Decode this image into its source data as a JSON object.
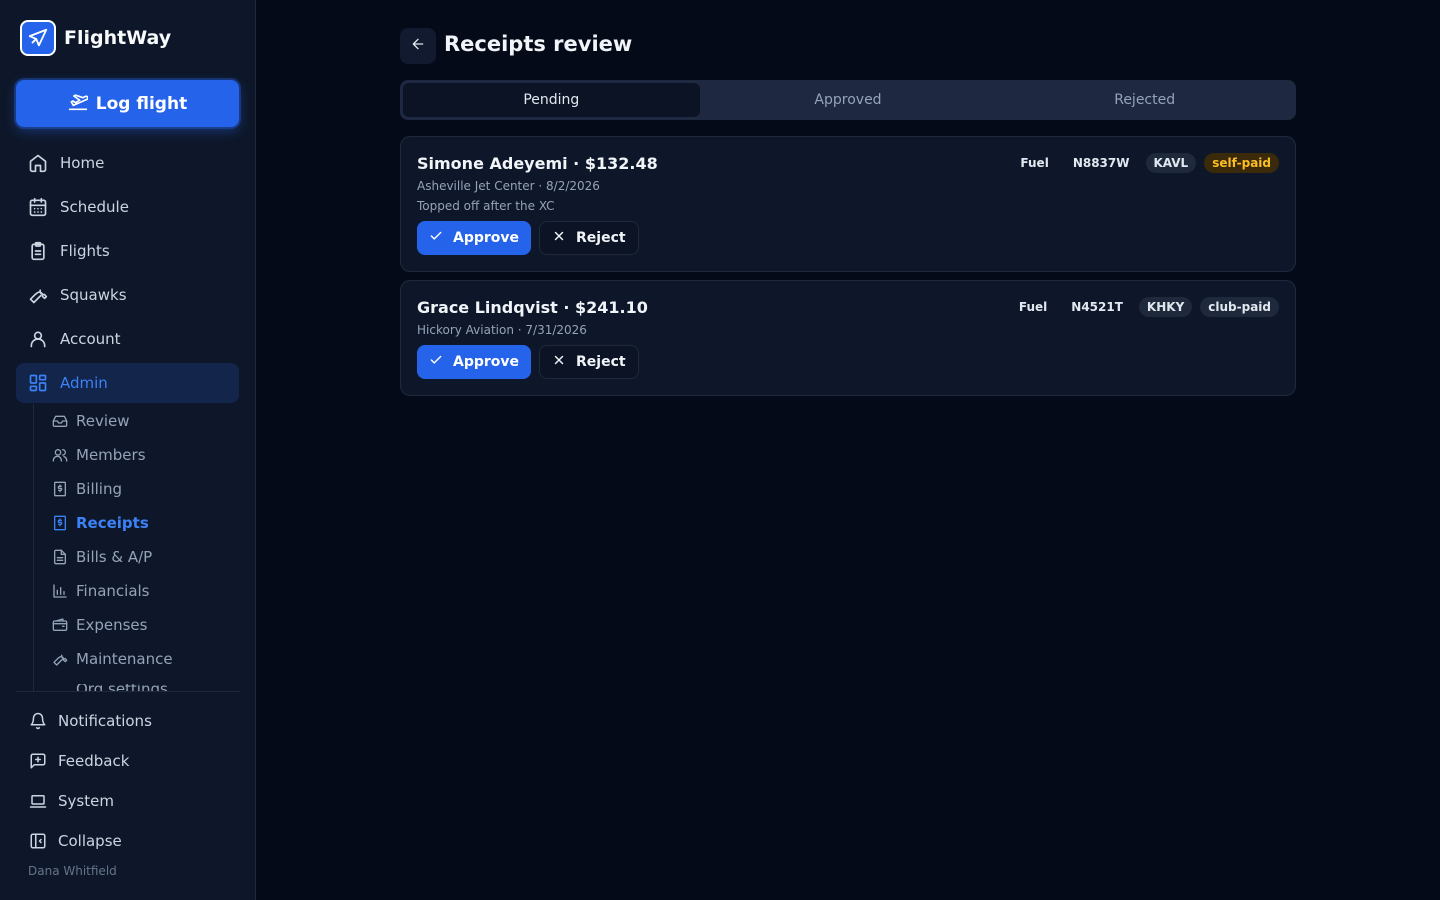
{
  "brand": {
    "name": "FlightWay"
  },
  "sidebar": {
    "log_flight_label": "Log flight",
    "items": [
      {
        "label": "Home",
        "icon": "home-icon"
      },
      {
        "label": "Schedule",
        "icon": "calendar-icon"
      },
      {
        "label": "Flights",
        "icon": "clipboard-icon"
      },
      {
        "label": "Squawks",
        "icon": "wrench-icon"
      },
      {
        "label": "Account",
        "icon": "user-icon"
      },
      {
        "label": "Admin",
        "icon": "grid-icon",
        "active": true
      }
    ],
    "admin_sub": [
      {
        "label": "Review",
        "icon": "inbox-icon"
      },
      {
        "label": "Members",
        "icon": "users-icon"
      },
      {
        "label": "Billing",
        "icon": "receipt-icon"
      },
      {
        "label": "Receipts",
        "icon": "receipt-icon",
        "active": true
      },
      {
        "label": "Bills & A/P",
        "icon": "file-icon"
      },
      {
        "label": "Financials",
        "icon": "bar-chart-icon"
      },
      {
        "label": "Expenses",
        "icon": "wallet-icon"
      },
      {
        "label": "Maintenance",
        "icon": "wrench-icon"
      },
      {
        "label": "Org settings",
        "icon": "gear-icon"
      }
    ],
    "footer": [
      {
        "label": "Notifications",
        "icon": "bell-icon"
      },
      {
        "label": "Feedback",
        "icon": "message-plus-icon"
      },
      {
        "label": "System",
        "icon": "laptop-icon"
      },
      {
        "label": "Collapse",
        "icon": "collapse-icon"
      }
    ],
    "user_name": "Dana Whitfield"
  },
  "header": {
    "title": "Receipts review"
  },
  "tabs": [
    {
      "label": "Pending",
      "active": true
    },
    {
      "label": "Approved"
    },
    {
      "label": "Rejected"
    }
  ],
  "receipts": [
    {
      "title": "Simone Adeyemi · $132.48",
      "vendor_date": "Asheville Jet Center · 8/2/2026",
      "note": "Topped off after the XC",
      "category": "Fuel",
      "tail": "N8837W",
      "airport": "KAVL",
      "payment": "self-paid"
    },
    {
      "title": "Grace Lindqvist · $241.10",
      "vendor_date": "Hickory Aviation · 7/31/2026",
      "category": "Fuel",
      "tail": "N4521T",
      "airport": "KHKY",
      "payment": "club-paid"
    }
  ],
  "actions": {
    "approve_label": "Approve",
    "reject_label": "Reject"
  }
}
